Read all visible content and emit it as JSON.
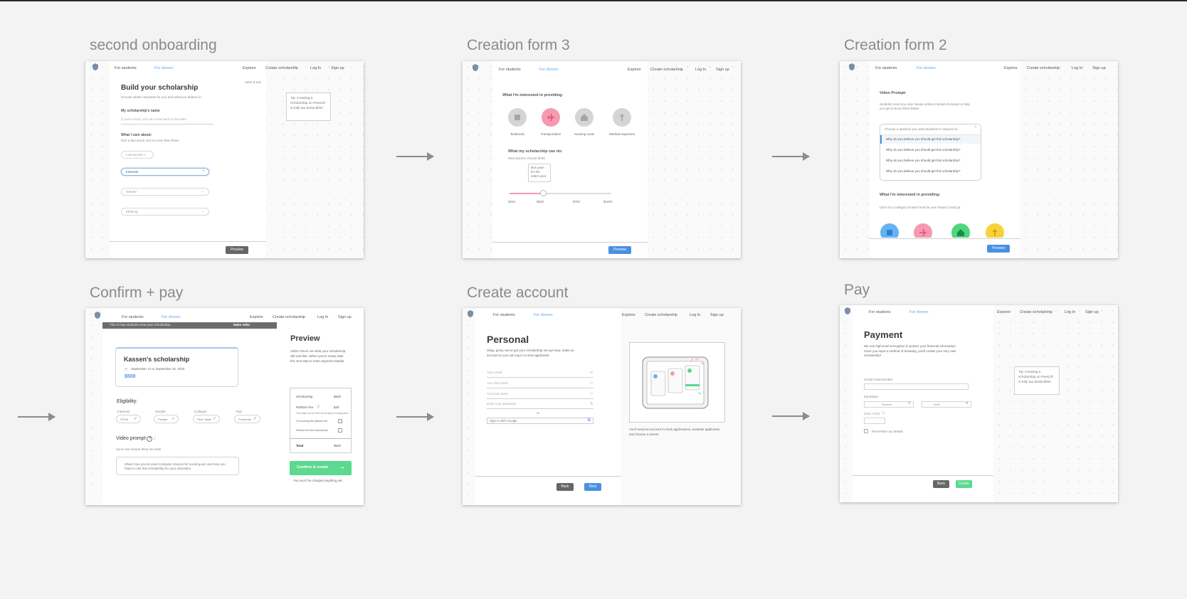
{
  "boards": {
    "second_onboarding": "second onboarding",
    "creation_form_3": "Creation form 3",
    "creation_form_2": "Creation form 2",
    "confirm_pay": "Confirm + pay",
    "create_account": "Create account",
    "pay": "Pay"
  },
  "nav": {
    "for_students": "For students",
    "for_donors": "For donors",
    "explore": "Explore",
    "create_scholarship": "Create scholarship",
    "log_in": "Log In",
    "sign_up": "Sign up"
  },
  "onboarding": {
    "save_exit": "Save & exit",
    "title": "Build your scholarship",
    "subtitle": "Choose what's important for you and what you believe in.",
    "name_label": "My scholarship's name",
    "name_placeholder": "If you're stuck, you can come back to this later",
    "care_label": "What I care about:",
    "care_sub": "Pick a few areas, but no more than three.",
    "low_income": "Low income  +",
    "interests": "Interests",
    "gender": "Gender",
    "ethnicity": "Ethnicity",
    "tip": "Tip:  Creating a scholarship on PeerLift is fully tax-deductible!",
    "preview": "Preview"
  },
  "form3": {
    "providing_title": "What I'm interested in providing:",
    "categories": [
      "Textbooks",
      "Transportation",
      "Housing costs",
      "Medical expenses"
    ],
    "can_do_title": "What my scholarship can do:",
    "can_do_sub": "Most donors choose $750",
    "tooltip": "Bus pass for the entire year.",
    "ticks": [
      "$250",
      "$500",
      "$750",
      "$1000"
    ],
    "slider_value": 500,
    "preview": "Preview"
  },
  "form2": {
    "video_title": "Video Prompt:",
    "video_sub": "Students send you nine minute videos instead of essays to help you get to know them better.",
    "select_placeholder": "Choose a question you want students to respond to",
    "options": [
      "Why do you believe you should get this scholarship?",
      "Why do you believe you should get this scholarship?",
      "Why do you believe you should get this scholarship?",
      "Why do you believe you should get this scholarship?"
    ],
    "providing_title": "What I'm interested in providing:",
    "providing_sub": "Click on a category to learn how far your impact could go.",
    "preview": "Preview"
  },
  "confirm": {
    "banner": "This is how students view your scholarship.",
    "make_edits": "Make edits",
    "card_title": "Kassen's scholarship",
    "card_dates": "September 12 to September 18, 2019",
    "card_amount": "$500",
    "eligibility": "Eligibility:",
    "elig_labels": [
      "Interests",
      "Gender",
      "Colleges",
      "Year"
    ],
    "elig_values": [
      "STEM",
      "Female",
      "Penn State",
      "Freshman"
    ],
    "video_prompt": "Video prompt",
    "video_sub": "Up to one minute thirty seconds",
    "video_text": "Share how you've used computer science for social good, and how you hope to use this scholarship for your education.",
    "preview_title": "Preview",
    "preview_text": "Voila!  Check out what your scholarship will look like.  When you're ready, take the next step to enter payment details.",
    "scholarship_label": "Scholarship",
    "scholarship_value": "$500",
    "fee_label": "Platform fee",
    "fee_value": "$30",
    "fee_note": "This helps us run PeerLift and keep it independent",
    "cover_label": "I'm covering the platform fee",
    "reduce_label": "Reduce the from scholarship",
    "total_label": "Total",
    "total_value": "$530",
    "confirm_btn": "Confirm & create",
    "note": "You won't be charged anything yet."
  },
  "account": {
    "title": "Personal",
    "text": "Okay, great, we've got your scholarship set up!  Now, make an account so you can log in to view applicants.",
    "email": "Your email",
    "first_name": "Your first name",
    "last_name": "Your last name",
    "password": "Enter your password",
    "or": "or",
    "google": "Sign in with Google",
    "side_text": "You'll need an account to track applications, evaluate applicants, and choose a winner.",
    "back": "Back",
    "next": "Next"
  },
  "pay": {
    "title": "Payment",
    "text": "We use high level encryption to protect your financial information.  Once you input a method of donating, you'll create your very own scholarship!",
    "card_label": "Credit Card Number",
    "expiration_label": "Expiration",
    "month": "October",
    "year": "2020",
    "cvc_label": "CVC / CVV",
    "remember": "Remember my details",
    "tip": "Tip:  Creating a scholarship on PeerLift is fully tax-deductible!",
    "back": "Back",
    "create": "Create"
  },
  "colors": {
    "blue": "#4a90e2",
    "green": "#5ad98f",
    "pink": "#f59ab0",
    "dark_button": "#666666"
  }
}
